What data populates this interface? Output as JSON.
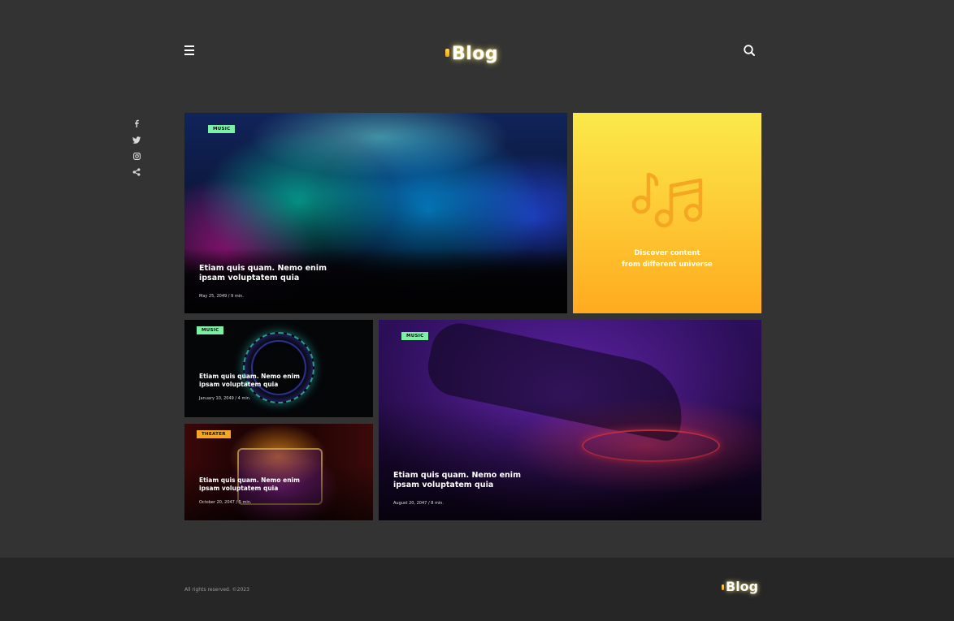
{
  "header": {
    "logo_text": "Blog",
    "menu_icon": "hamburger-icon",
    "search_icon": "search-icon"
  },
  "social": [
    {
      "name": "facebook-icon",
      "glyph": "f"
    },
    {
      "name": "twitter-icon",
      "glyph": "t"
    },
    {
      "name": "instagram-icon",
      "glyph": "i"
    },
    {
      "name": "share-icon",
      "glyph": "s"
    }
  ],
  "posts": [
    {
      "tag": "MUSIC",
      "title_line1": "Etiam quis quam. Nemo enim",
      "title_line2": "ipsam voluptatem quia",
      "meta": "May 25, 2049 / 9 min."
    },
    {
      "tag": "MUSIC",
      "title_line1": "Etiam quis quam. Nemo enim",
      "title_line2": "ipsam voluptatem quia",
      "meta": "January 10, 2049 / 4 min."
    },
    {
      "tag": "THEATER",
      "title_line1": "Etiam quis quam. Nemo enim",
      "title_line2": "ipsam voluptatem quia",
      "meta": "October 20, 2047 / 5 min."
    },
    {
      "tag": "MUSIC",
      "title_line1": "Etiam quis quam. Nemo enim",
      "title_line2": "ipsam voluptatem quia",
      "meta": "August 20, 2047 / 8 min."
    }
  ],
  "promo": {
    "line1": "Discover content",
    "line2": "from different universe",
    "icon": "music-notes-icon"
  },
  "footer": {
    "copyright": "All rights reserved. ©2023",
    "logo_text": "Blog"
  },
  "colors": {
    "background": "#333333",
    "footer": "#262626",
    "tag_music": "#7cf0a4",
    "tag_theater": "#f6a623",
    "promo_top": "#fbe94a",
    "promo_bottom": "#ffab1f"
  }
}
